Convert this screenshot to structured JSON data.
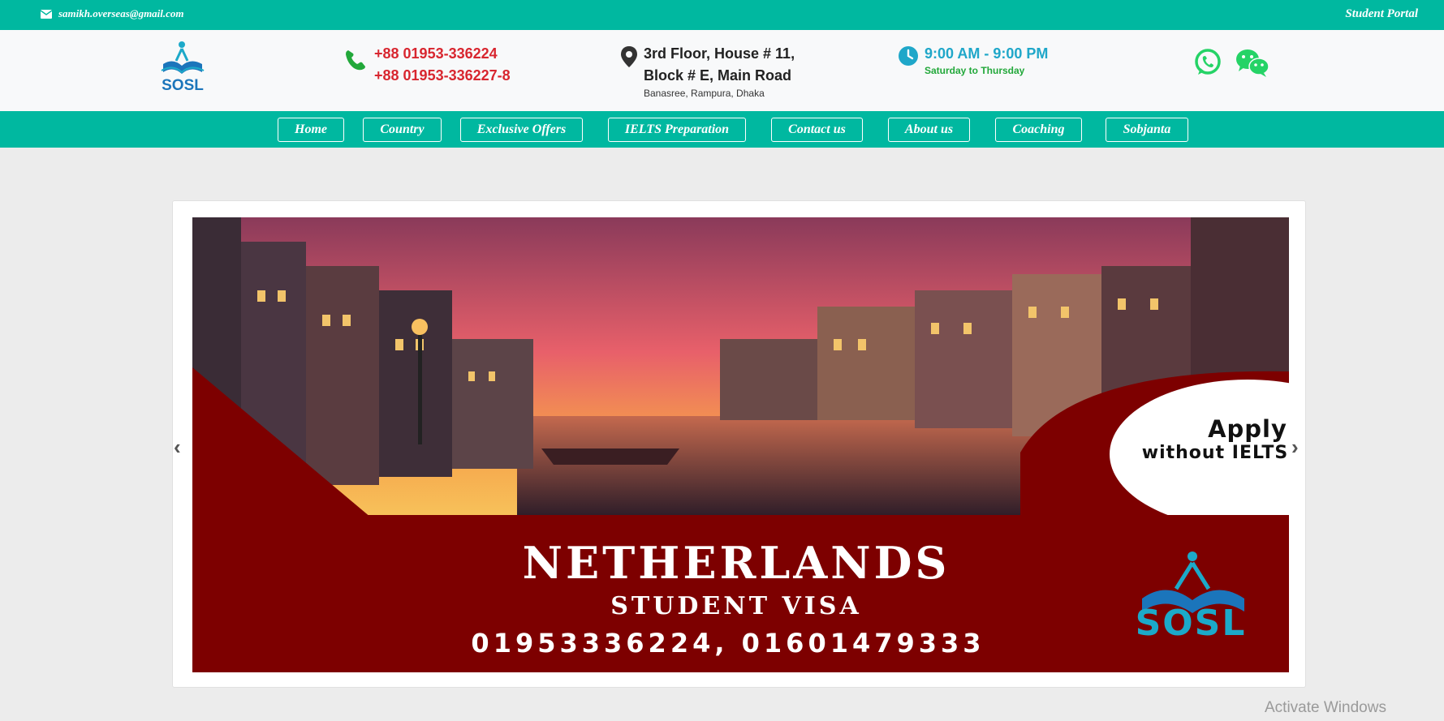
{
  "topbar": {
    "email": "samikh.overseas@gmail.com",
    "student_portal": "Student Portal"
  },
  "header": {
    "logo_text": "SOSL",
    "phone1": "+88 01953-336224",
    "phone2": "+88 01953-336227-8",
    "address_line1": "3rd Floor, House # 11,",
    "address_line2": "Block # E, Main Road",
    "address_line3": "Banasree, Rampura, Dhaka",
    "hours": "9:00 AM - 9:00 PM",
    "days": "Saturday to Thursday"
  },
  "nav": {
    "items": [
      {
        "label": "Home"
      },
      {
        "label": "Country"
      },
      {
        "label": "Exclusive Offers"
      },
      {
        "label": "IELTS Preparation"
      },
      {
        "label": "Contact us"
      },
      {
        "label": "About us"
      },
      {
        "label": "Coaching"
      },
      {
        "label": "Sobjanta"
      }
    ]
  },
  "slide": {
    "badge_line1": "Apply",
    "badge_line2": "without IELTS",
    "headline": "NETHERLANDS",
    "subheadline": "STUDENT VISA",
    "phones": "01953336224, 01601479333",
    "logo_text": "SOSL"
  },
  "carousel": {
    "prev_glyph": "‹",
    "next_glyph": "›"
  },
  "watermark": "Activate Windows",
  "colors": {
    "teal": "#00b8a0",
    "maroon": "#7d0000",
    "phone_red": "#d8262f",
    "whatsapp_green": "#25d366"
  }
}
